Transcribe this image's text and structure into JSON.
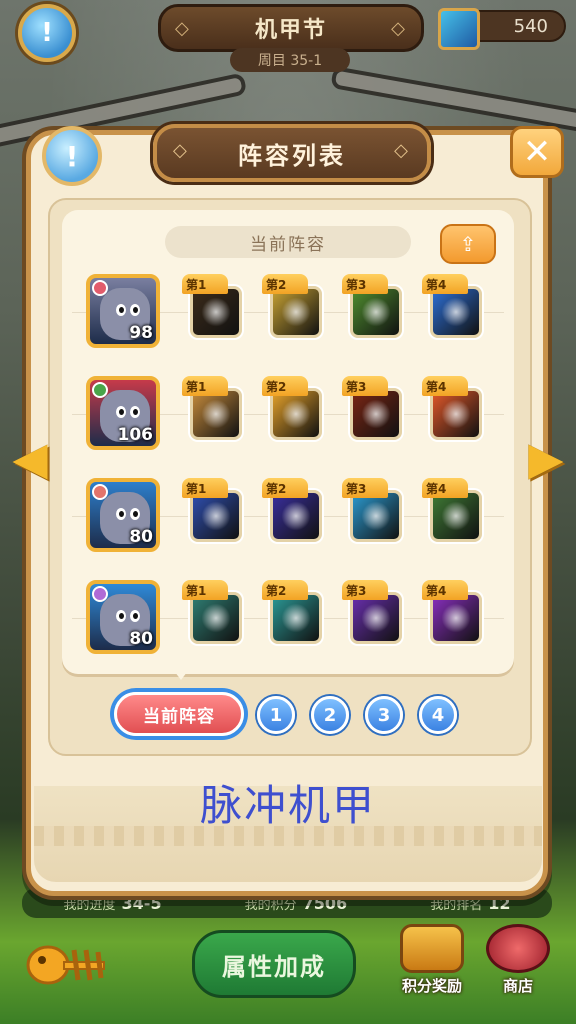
{
  "topbar": {
    "title": "机甲节",
    "subtitle": "周目 35-1",
    "currency": "540"
  },
  "modal": {
    "title": "阵容列表",
    "close": "✕",
    "info": "!"
  },
  "lineup": {
    "header": "当前阵容",
    "share_icon": "share-icon",
    "rows": [
      {
        "level": "98",
        "color": "#7a7fa0",
        "elem": "#e25c6b",
        "skills": [
          {
            "tag": "第1",
            "color": "#3b2b1a"
          },
          {
            "tag": "第2",
            "color": "#c8a233"
          },
          {
            "tag": "第3",
            "color": "#4f8e2f"
          },
          {
            "tag": "第4",
            "color": "#2d6fd6"
          }
        ]
      },
      {
        "level": "106",
        "color": "#c63a4a",
        "elem": "#49a54a",
        "skills": [
          {
            "tag": "第1",
            "color": "#c68b3c"
          },
          {
            "tag": "第2",
            "color": "#e6a22a"
          },
          {
            "tag": "第3",
            "color": "#7a2614"
          },
          {
            "tag": "第4",
            "color": "#e3592a"
          }
        ]
      },
      {
        "level": "80",
        "color": "#2d7fcc",
        "elem": "#e2746b",
        "skills": [
          {
            "tag": "第1",
            "color": "#2f4fb0"
          },
          {
            "tag": "第2",
            "color": "#3a2f9e"
          },
          {
            "tag": "第3",
            "color": "#2b9ad0"
          },
          {
            "tag": "第4",
            "color": "#3f7a35"
          }
        ]
      },
      {
        "level": "80",
        "color": "#2f8ad8",
        "elem": "#b06bd6",
        "skills": [
          {
            "tag": "第1",
            "color": "#2f7f74"
          },
          {
            "tag": "第2",
            "color": "#2b9a97"
          },
          {
            "tag": "第3",
            "color": "#6a2fb0"
          },
          {
            "tag": "第4",
            "color": "#8a2fc0"
          }
        ]
      }
    ]
  },
  "tabs": {
    "current": "当前阵容",
    "numbers": [
      "1",
      "2",
      "3",
      "4"
    ]
  },
  "caption": "脉冲机甲",
  "behind": {
    "progress_label": "我的进度",
    "progress_value": "34-5",
    "score_label": "我的积分",
    "score_value": "7506",
    "rank_label": "我的排名",
    "rank_value": "12",
    "attr_button": "属性加成",
    "reward_label": "积分奖励",
    "shop_label": "商店"
  }
}
